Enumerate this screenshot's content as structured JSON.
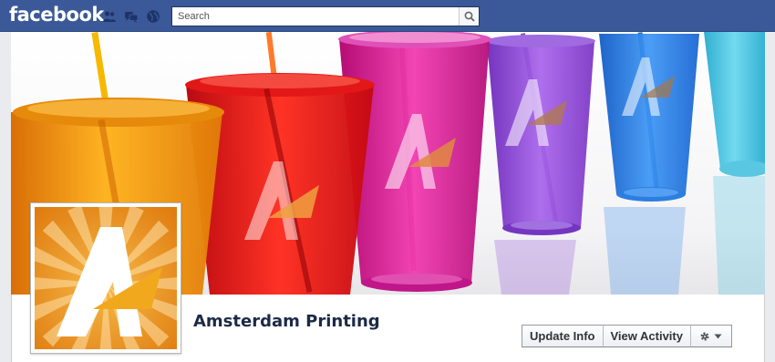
{
  "header": {
    "logo": "facebook",
    "search_placeholder": "Search"
  },
  "icons": {
    "friend_requests": "friends-icon",
    "messages": "messages-icon",
    "notifications": "globe-icon",
    "search": "search-icon",
    "settings": "gear-icon",
    "dropdown": "caret-down-icon"
  },
  "page": {
    "name": "Amsterdam Printing"
  },
  "actions": {
    "update_info": "Update Info",
    "view_activity": "View Activity"
  },
  "colors": {
    "facebook_blue": "#3b5998",
    "brand_orange": "#e28a1e",
    "cups": [
      "#f29a18",
      "#e8141a",
      "#d4178e",
      "#8c3fd3",
      "#1f7fe6",
      "#2fb8d8"
    ]
  }
}
